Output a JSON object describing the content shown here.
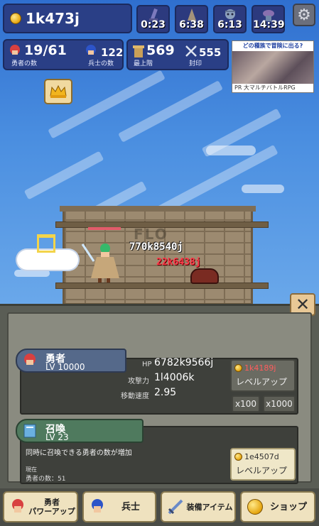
{
  "hud": {
    "gold": "1k473j",
    "timers": [
      {
        "icon": "sword-icon",
        "value": "0:23"
      },
      {
        "icon": "drill-icon",
        "value": "6:38"
      },
      {
        "icon": "skull-icon",
        "value": "6:13"
      },
      {
        "icon": "potion-icon",
        "value": "14:39"
      }
    ],
    "settings_icon": "gear-icon",
    "heroes_count": "19/61",
    "heroes_label": "勇者の数",
    "soldiers_count": "122",
    "soldiers_label": "兵士の数",
    "top_floor": "569",
    "top_floor_label": "最上階",
    "seal_count": "555",
    "seal_label": "封印"
  },
  "ad": {
    "top_text": "どの種族で冒険に出る?",
    "bottom_text": "PR 大マルチバトルRPG"
  },
  "battle": {
    "damage_white": "770k8540j",
    "damage_red": "22k6438j",
    "wall_text": "FLO"
  },
  "hero_card": {
    "name": "勇者",
    "level": "LV 10000",
    "hp_label": "HP",
    "hp_value": "6782k9566j",
    "atk_label": "攻撃力",
    "atk_value": "1l4006k",
    "speed_label": "移動速度",
    "speed_value": "2.95",
    "cost": "1k4189j",
    "level_up": "レベルアップ",
    "x100": "x100",
    "x1000": "x1000"
  },
  "summon_card": {
    "name": "召喚",
    "level": "LV 23",
    "description": "同時に召喚できる勇者の数が増加",
    "current_label": "現在",
    "current_value": "勇者の数：51",
    "cost": "1e4507d",
    "level_up": "レベルアップ"
  },
  "nav": {
    "hero_power": "勇者\nパワーアップ",
    "soldier": "兵士",
    "equipment": "装備アイテム",
    "shop": "ショップ"
  },
  "colors": {
    "sky": "#3a73c4",
    "hud": "#2a3f86",
    "panel": "#5a5d55",
    "gold": "#e5a50f",
    "accent_red": "#ff5d5d"
  }
}
